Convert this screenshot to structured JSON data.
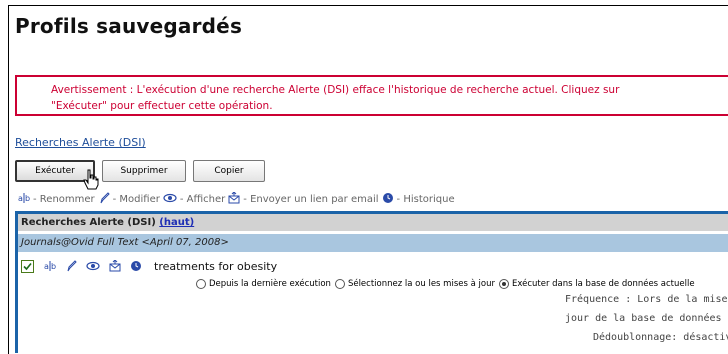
{
  "page": {
    "title": "Profils sauvegardés"
  },
  "warning": {
    "line1": "Avertissement : L'exécution d'une recherche Alerte (DSI) efface l'historique de recherche actuel. Cliquez sur",
    "line2": "\"Exécuter\" pour effectuer cette opération."
  },
  "alerts_link": "Recherches Alerte (DSI)",
  "buttons": {
    "execute": "Exécuter",
    "delete": "Supprimer",
    "copy": "Copier"
  },
  "legend": {
    "rename": "- Renommer",
    "modify": "- Modifier",
    "view": "- Afficher",
    "email": "- Envoyer un lien par email",
    "history": "- Historique",
    "icons": [
      "rename-icon",
      "edit-pencil-icon",
      "eye-icon",
      "email-icon",
      "history-clock-icon"
    ]
  },
  "panel": {
    "header": "Recherches Alerte (DSI)",
    "top_link": "(haut)",
    "database": "Journals@Ovid Full Text <April 07, 2008>",
    "item": {
      "checked": true,
      "title": "treatments for obesity",
      "options": [
        {
          "label": "Depuis la dernière exécution",
          "selected": false
        },
        {
          "label": "Sélectionnez la ou les mises à jour",
          "selected": false
        },
        {
          "label": "Exécuter dans la base de données actuelle",
          "selected": true
        }
      ],
      "frequency_line1": "Fréquence : Lors de la mise à",
      "frequency_line2": "jour de la base de données",
      "dedup": "Dédoublonnage: désactivé"
    }
  },
  "colors": {
    "warning": "#cc0033",
    "panel_border": "#1b63a8",
    "db_row": "#a9c6df",
    "header_row": "#d2d2d2",
    "link": "#1f4e9a"
  }
}
